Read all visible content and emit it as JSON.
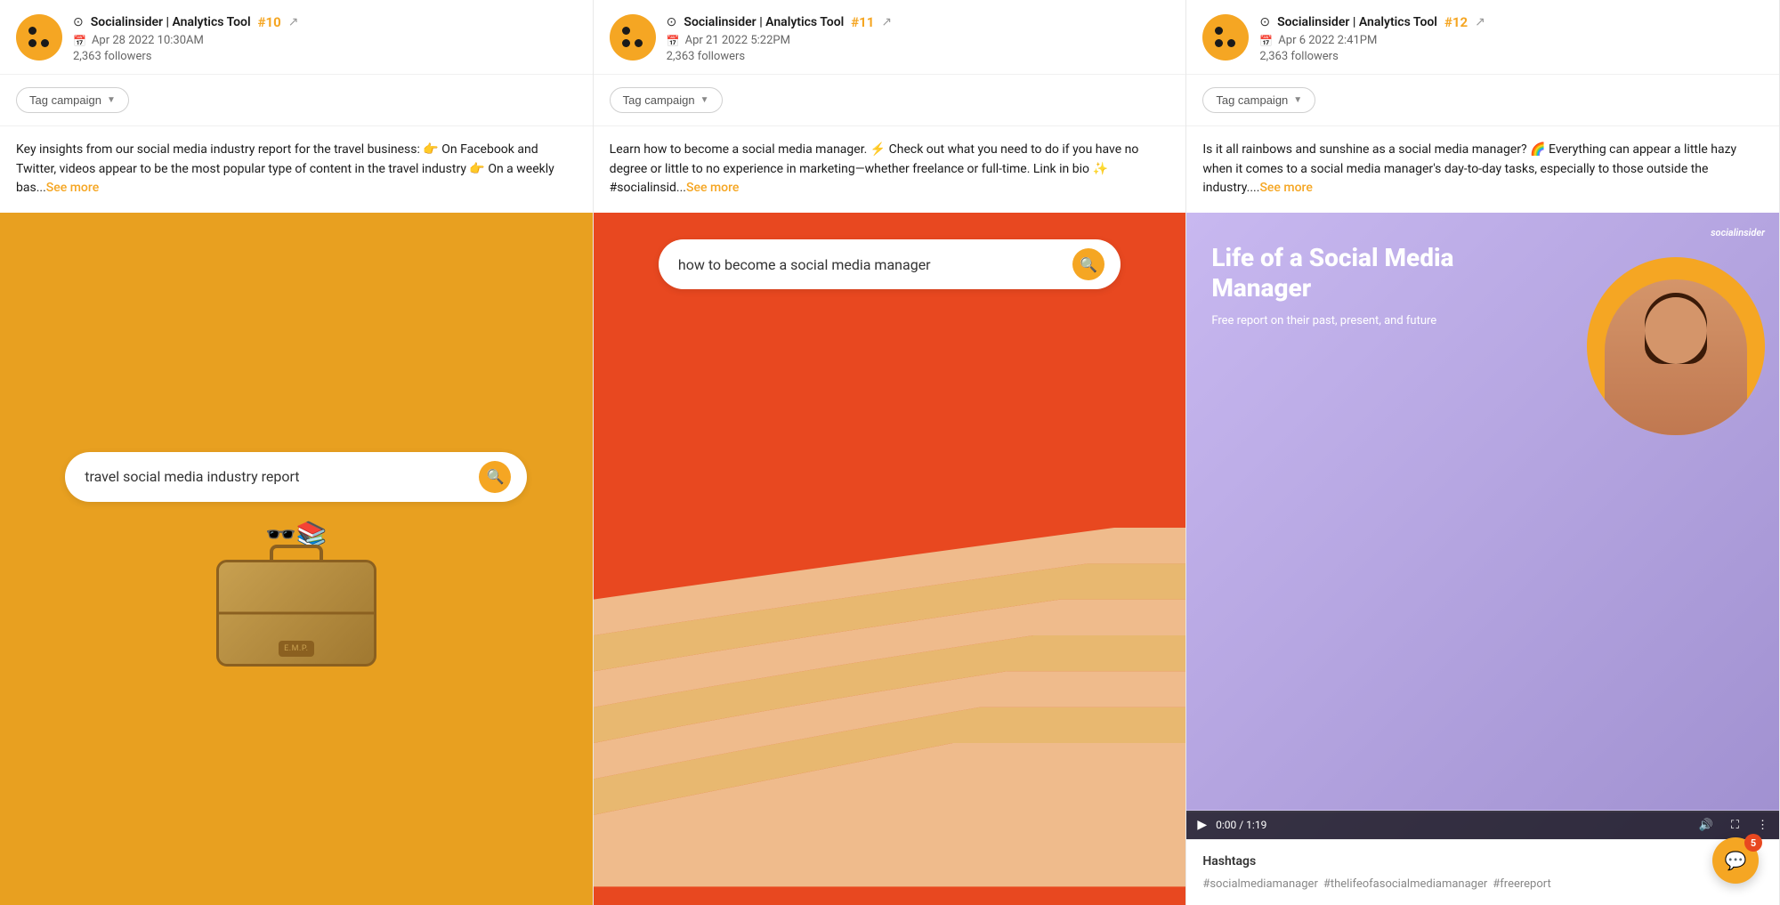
{
  "cards": [
    {
      "id": "card-10",
      "account": "Socialinsider | Analytics Tool",
      "post_number": "#10",
      "date": "Apr 28 2022 10:30AM",
      "followers": "2,363 followers",
      "tag_label": "Tag campaign",
      "post_text": "Key insights from our social media industry report for the travel business: 👉 On Facebook and Twitter, videos appear to be the most popular type of content in the travel industry 👉 On a weekly bas...",
      "see_more": "See more",
      "image_search_text": "travel social media industry report",
      "image_type": "suitcase"
    },
    {
      "id": "card-11",
      "account": "Socialinsider | Analytics Tool",
      "post_number": "#11",
      "date": "Apr 21 2022 5:22PM",
      "followers": "2,363 followers",
      "tag_label": "Tag campaign",
      "post_text": "Learn how to become a social media manager. ⚡ Check out what you need to do if you have no degree or little to no experience in marketing—whether freelance or full-time. Link in bio ✨ #socialinsid...",
      "see_more": "See more",
      "image_search_text": "how to become a social media manager",
      "image_type": "stairs"
    },
    {
      "id": "card-12",
      "account": "Socialinsider | Analytics Tool",
      "post_number": "#12",
      "date": "Apr 6 2022 2:41PM",
      "followers": "2,363 followers",
      "tag_label": "Tag campaign",
      "post_text": "Is it all rainbows and sunshine as a social media manager? 🌈 Everything can appear a little hazy when it comes to a social media manager's day-to-day tasks, especially to those outside the industry....",
      "see_more": "See more",
      "image_type": "video",
      "video_title": "Life of a Social Media Manager",
      "video_subtitle": "Free report on their past, present, and future",
      "video_brand": "socialinsider",
      "video_time": "0:00 / 1:19",
      "hashtags_title": "Hashtags",
      "hashtags": [
        "#socialmediamanager",
        "#thelifeofasocialmediamanager",
        "#freereport"
      ]
    }
  ],
  "chat": {
    "badge": "5",
    "icon": "💬"
  }
}
